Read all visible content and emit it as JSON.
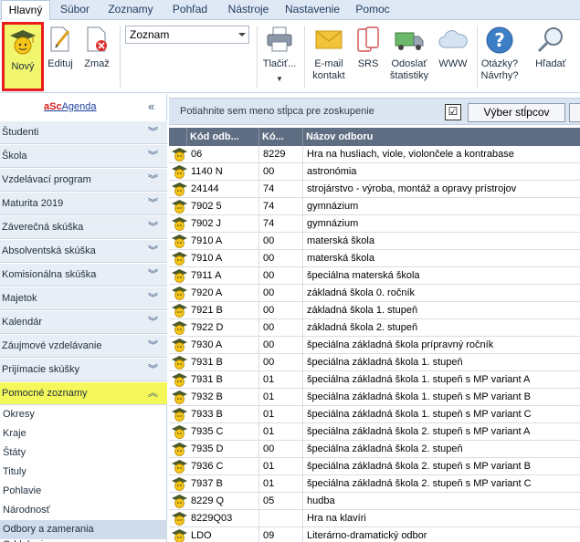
{
  "menu": {
    "tabs": [
      {
        "label": "Hlavný",
        "active": true
      },
      {
        "label": "Súbor"
      },
      {
        "label": "Zoznamy"
      },
      {
        "label": "Pohľad"
      },
      {
        "label": "Nástroje"
      },
      {
        "label": "Nastavenie"
      },
      {
        "label": "Pomoc"
      }
    ]
  },
  "ribbon": {
    "novy": "Nový",
    "edituj": "Edituj",
    "zmaz": "Zmaž",
    "combo_value": "Zoznam",
    "tlacit": "Tlačiť...",
    "email_line1": "E-mail",
    "email_line2": "kontakt",
    "srs": "SRS",
    "odoslat_line1": "Odoslať",
    "odoslat_line2": "štatistiky",
    "www": "WWW",
    "otazky_line1": "Otázky?",
    "otazky_line2": "Návrhy?",
    "hladat": "Hľadať"
  },
  "brand": {
    "asc": "aSc",
    "agenda": "Agenda",
    "collapse_glyph": "«"
  },
  "nav": {
    "items": [
      {
        "label": "Študenti"
      },
      {
        "label": "Škola"
      },
      {
        "label": "Vzdelávací program"
      },
      {
        "label": "Maturita 2019"
      },
      {
        "label": "Záverečná skúška"
      },
      {
        "label": "Absolventská skúška"
      },
      {
        "label": "Komisionálna skúška"
      },
      {
        "label": "Majetok"
      },
      {
        "label": "Kalendár"
      },
      {
        "label": "Záujmové vzdelávanie"
      },
      {
        "label": "Prijímacie skúšky"
      },
      {
        "label": "Pomocné zoznamy",
        "active": true
      }
    ],
    "sub_items": [
      {
        "label": "Okresy"
      },
      {
        "label": "Kraje"
      },
      {
        "label": "Štáty"
      },
      {
        "label": "Tituly"
      },
      {
        "label": "Pohlavie"
      },
      {
        "label": "Národnosť"
      },
      {
        "label": "Odbory a zamerania",
        "selected": true
      },
      {
        "label": "Oddelenia"
      }
    ]
  },
  "grid": {
    "group_hint": "Potiahnite sem meno stĺpca pre zoskupenie",
    "checkbox_glyph": "☑",
    "columns_button": "Výber stĺpcov",
    "columns": [
      "Kód odb...",
      "Kó...",
      "Názov odboru"
    ],
    "rows": [
      [
        "06",
        "8229",
        "Hra na husliach, viole, violončele a kontrabase"
      ],
      [
        "1140 N",
        "00",
        "astronómia"
      ],
      [
        "24144",
        "74",
        "strojárstvo - výroba, montáž a opravy prístrojov"
      ],
      [
        "7902 5",
        "74",
        "gymnázium"
      ],
      [
        "7902 J",
        "74",
        "gymnázium"
      ],
      [
        "7910 A",
        "00",
        "materská škola"
      ],
      [
        "7910 A",
        "00",
        "materská škola"
      ],
      [
        "7911 A",
        "00",
        "špeciálna materská škola"
      ],
      [
        "7920 A",
        "00",
        "základná škola 0. ročník"
      ],
      [
        "7921 B",
        "00",
        "základná škola 1. stupeň"
      ],
      [
        "7922 D",
        "00",
        "základná škola 2. stupeň"
      ],
      [
        "7930 A",
        "00",
        "špeciálna základná škola prípravný ročník"
      ],
      [
        "7931 B",
        "00",
        "špeciálna základná škola 1. stupeň"
      ],
      [
        "7931 B",
        "01",
        "špeciálna základná škola 1. stupeň s MP variant A"
      ],
      [
        "7932 B",
        "01",
        "špeciálna základná škola 1. stupeň s MP variant B"
      ],
      [
        "7933 B",
        "01",
        "špeciálna základná škola 1. stupeň s MP variant C"
      ],
      [
        "7935 C",
        "01",
        "špeciálna základná škola 2. stupeň s MP variant A"
      ],
      [
        "7935 D",
        "00",
        "špeciálna základná škola 2. stupeň"
      ],
      [
        "7936 C",
        "01",
        "špeciálna základná škola 2. stupeň s MP variant B"
      ],
      [
        "7937 B",
        "01",
        "špeciálna základná škola 2. stupeň s MP variant C"
      ],
      [
        "8229 Q",
        "05",
        "hudba"
      ],
      [
        "8229Q03",
        "",
        "Hra na klavíri"
      ],
      [
        "LDO",
        "09",
        "Literárno-dramatický odbor"
      ]
    ]
  }
}
